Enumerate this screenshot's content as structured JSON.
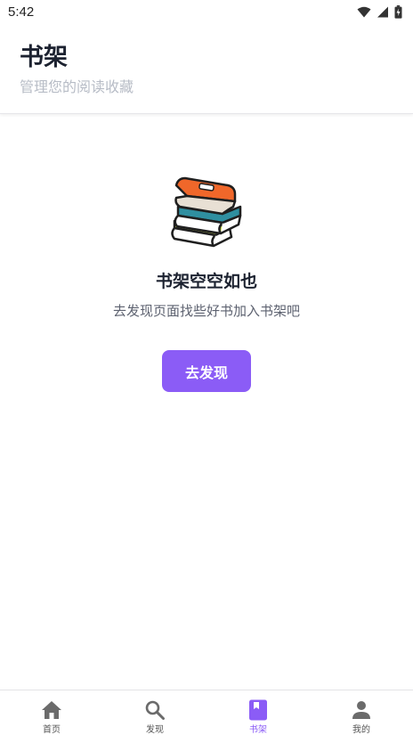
{
  "status_bar": {
    "time": "5:42"
  },
  "header": {
    "title": "书架",
    "subtitle": "管理您的阅读收藏"
  },
  "empty_state": {
    "title": "书架空空如也",
    "description": "去发现页面找些好书加入书架吧",
    "button_label": "去发现"
  },
  "bottom_nav": {
    "items": [
      {
        "label": "首页",
        "icon": "home-icon",
        "active": false
      },
      {
        "label": "发现",
        "icon": "search-icon",
        "active": false
      },
      {
        "label": "书架",
        "icon": "bookmark-book-icon",
        "active": true
      },
      {
        "label": "我的",
        "icon": "person-icon",
        "active": false
      }
    ]
  },
  "colors": {
    "accent": "#8b5cf6",
    "icon_gray": "#6b6b6b"
  }
}
